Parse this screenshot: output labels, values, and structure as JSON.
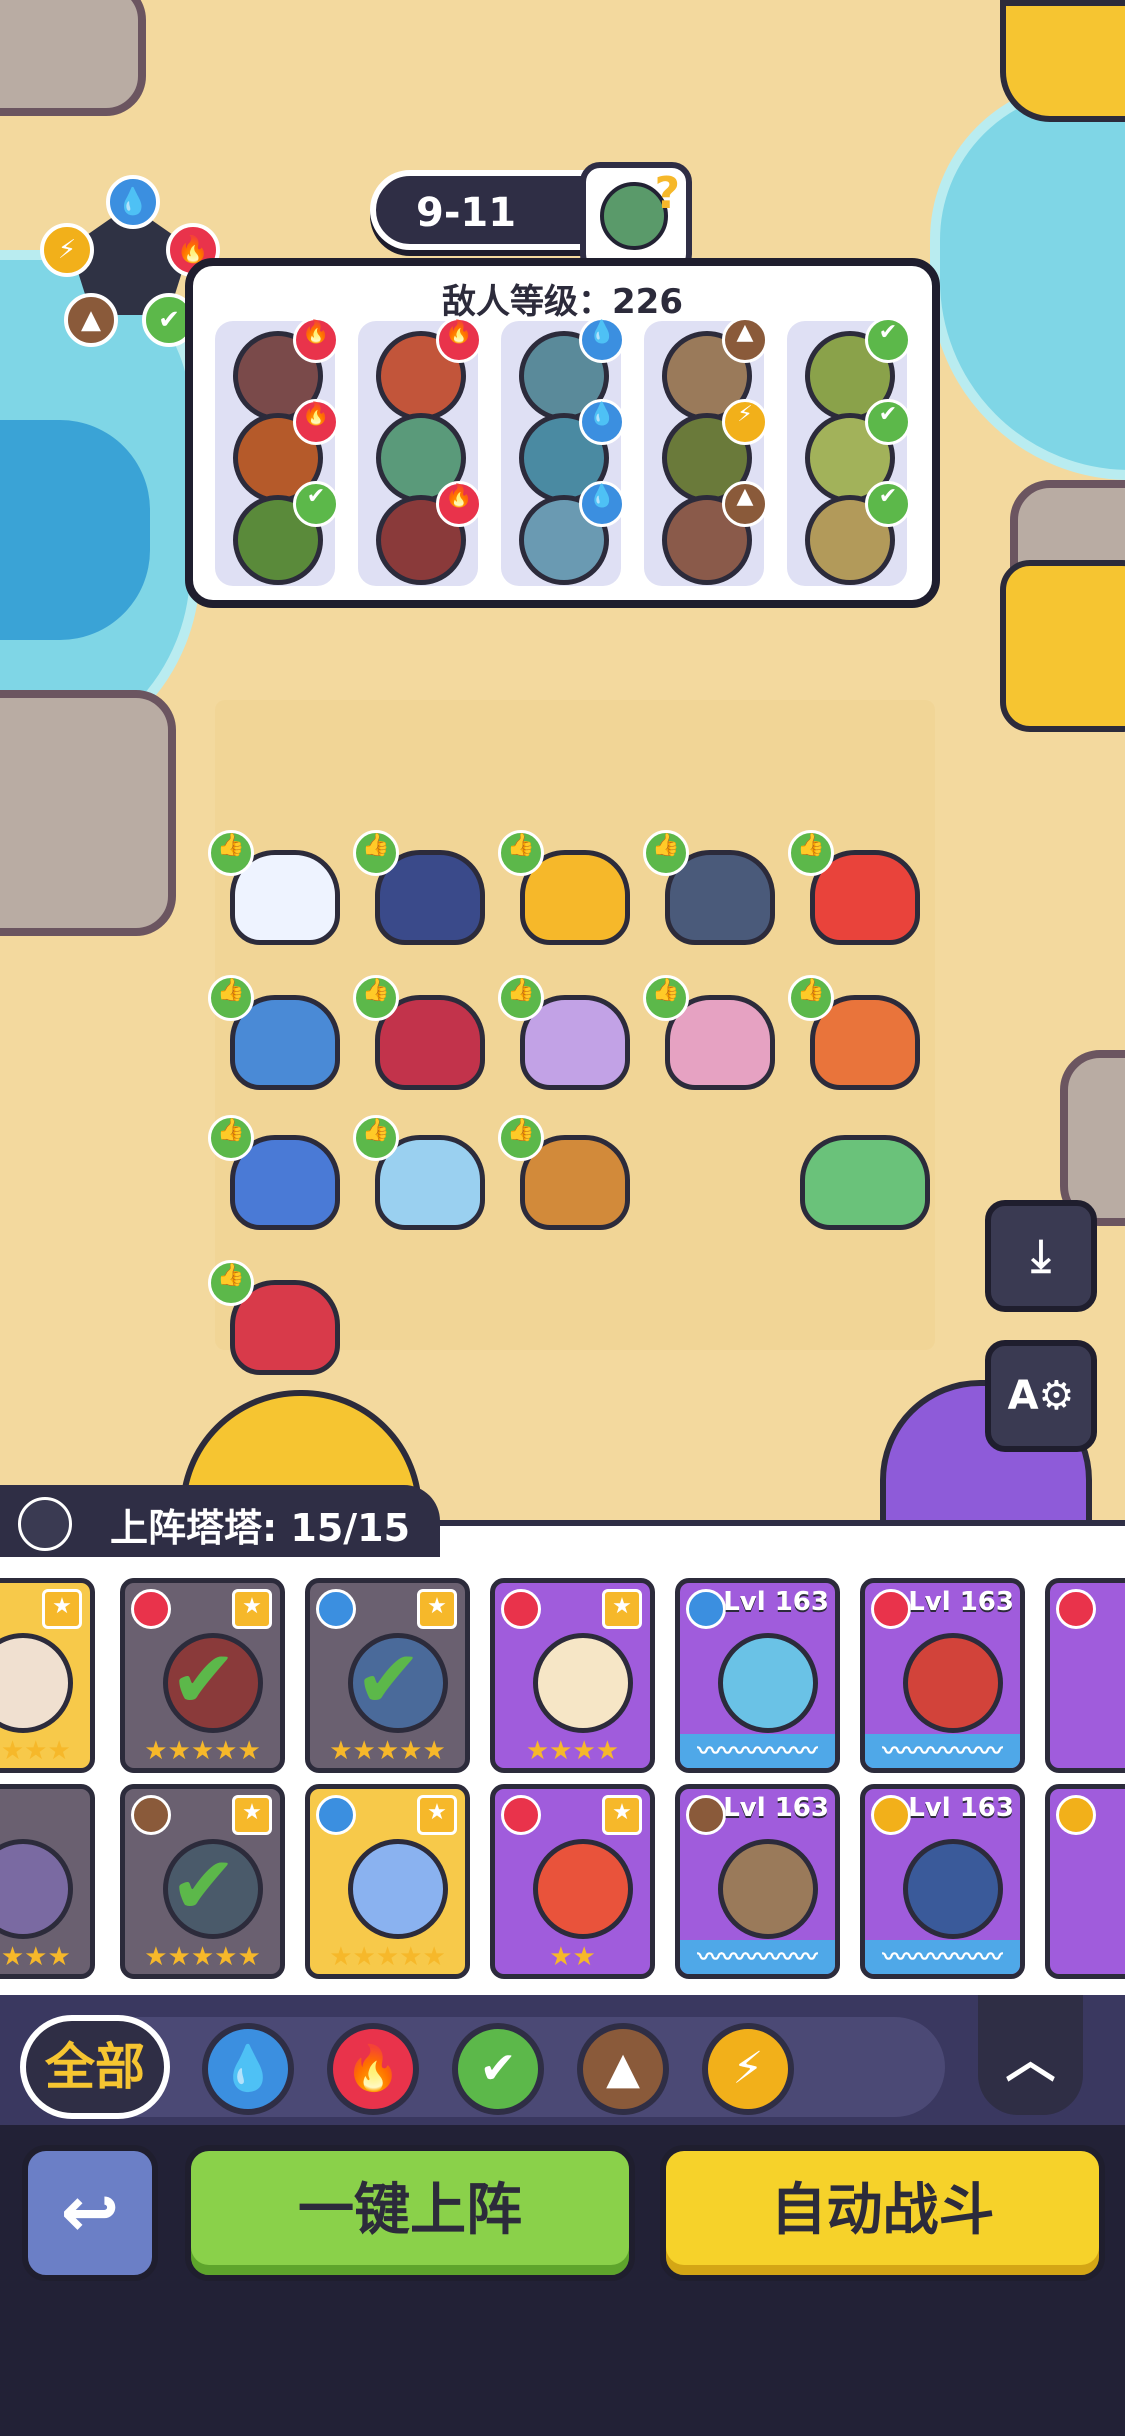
{
  "stage": {
    "label": "9-11"
  },
  "enemy_panel": {
    "title": "敌人等级：226",
    "columns": [
      {
        "badges": [
          "fire",
          "fire",
          "leaf"
        ]
      },
      {
        "badges": [
          "fire",
          "",
          "fire"
        ]
      },
      {
        "badges": [
          "water",
          "water",
          "water"
        ]
      },
      {
        "badges": [
          "earth",
          "bolt",
          "earth"
        ]
      },
      {
        "badges": [
          "leaf",
          "leaf",
          "leaf"
        ]
      }
    ]
  },
  "element_wheel": [
    "water",
    "fire",
    "leaf",
    "earth",
    "bolt"
  ],
  "team": {
    "label": "上阵塔塔: 15/15",
    "upgrade_icon": "👍"
  },
  "cards": {
    "row1": [
      {
        "level": "",
        "color": "yellow"
      },
      {
        "level": "",
        "color": "dark",
        "checked": true
      },
      {
        "level": "",
        "color": "dark",
        "checked": true
      },
      {
        "level": "",
        "color": "purple"
      },
      {
        "level": "Lvl 163",
        "color": "purple"
      },
      {
        "level": "Lvl 163",
        "color": "purple"
      }
    ],
    "row2": [
      {
        "level": "",
        "color": "dark"
      },
      {
        "level": "",
        "color": "dark",
        "checked": true
      },
      {
        "level": "",
        "color": "yellow"
      },
      {
        "level": "",
        "color": "purple"
      },
      {
        "level": "Lvl 163",
        "color": "purple"
      },
      {
        "level": "Lvl 163",
        "color": "purple"
      }
    ]
  },
  "filters": {
    "all_label": "全部",
    "elements": [
      "water-icon",
      "fire-icon",
      "leaf-icon",
      "earth-icon",
      "bolt-icon"
    ]
  },
  "buttons": {
    "deploy": "一键上阵",
    "auto_battle": "自动战斗"
  },
  "colors": {
    "water": "#3b8fe0",
    "fire": "#e9334b",
    "leaf": "#5cb84a",
    "earth": "#8a5a3a",
    "bolt": "#f2b01a"
  }
}
